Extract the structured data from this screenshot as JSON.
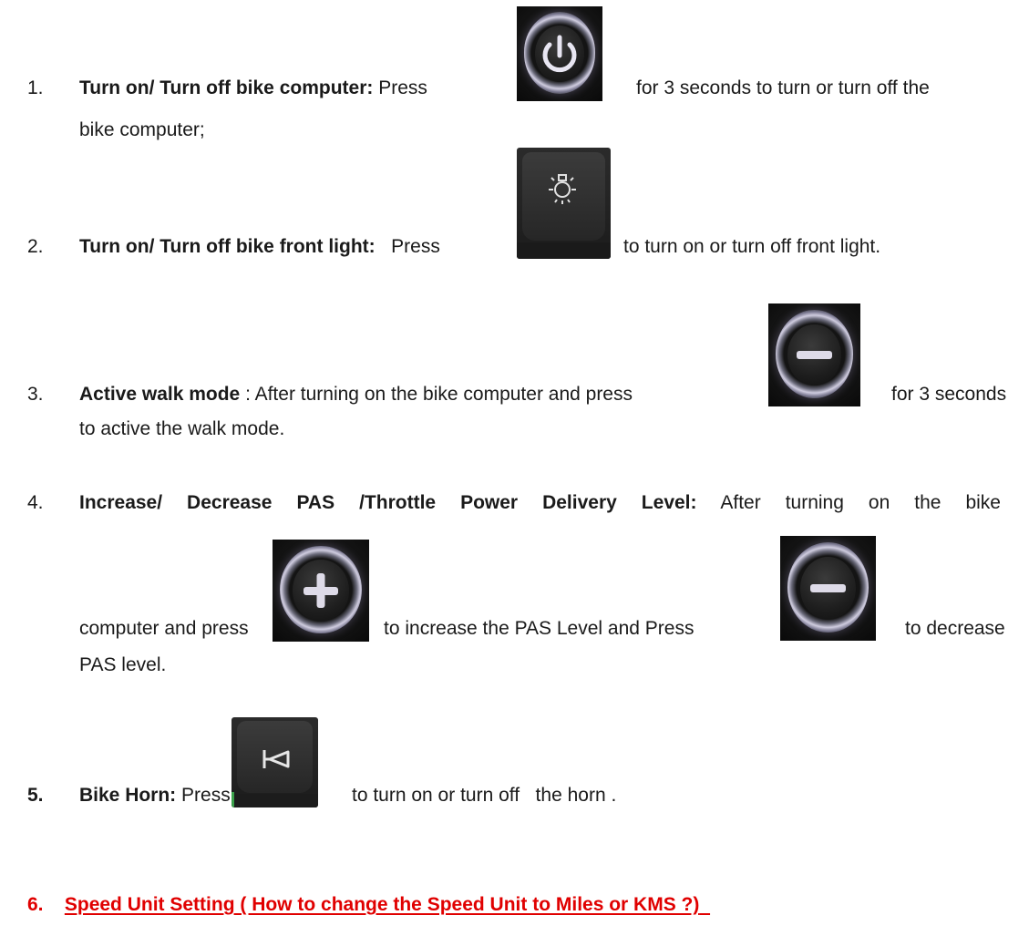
{
  "items": [
    {
      "number": "1.",
      "title": "Turn on/ Turn off bike computer:",
      "before": "Press",
      "after": "for 3 seconds to turn or turn off the",
      "line2": "bike computer;",
      "icon": "power-button-icon"
    },
    {
      "number": "2.",
      "title": "Turn on/ Turn off bike front light:",
      "before": "Press",
      "after": "to turn on or turn off front light.",
      "icon": "light-button-icon"
    },
    {
      "number": "3.",
      "title": "Active walk mode",
      "before": ": After turning on the bike computer and press",
      "after": "for 3 seconds",
      "line2": "to active the walk mode.",
      "icon": "minus-button-icon"
    },
    {
      "number": "4.",
      "title": "Increase/ Decrease PAS /Throttle Power Delivery Level:",
      "after_title": "After turning on the bike",
      "line2_a": "computer and press",
      "line2_b": "to increase the PAS Level and Press",
      "line2_c": "to decrease",
      "line3": "PAS level.",
      "icons": [
        "plus-button-icon",
        "minus-button-icon"
      ]
    },
    {
      "number": "5.",
      "title": "Bike Horn:",
      "before": "Press",
      "after": "to turn on or turn off   the horn .",
      "icon": "horn-button-icon"
    }
  ],
  "section_heading": {
    "number": "6.",
    "text": "Speed Unit Setting ( How to change the Speed Unit to Miles or KMS ?)"
  },
  "colors": {
    "heading_red": "#e00000",
    "text": "#1a1a1a"
  }
}
